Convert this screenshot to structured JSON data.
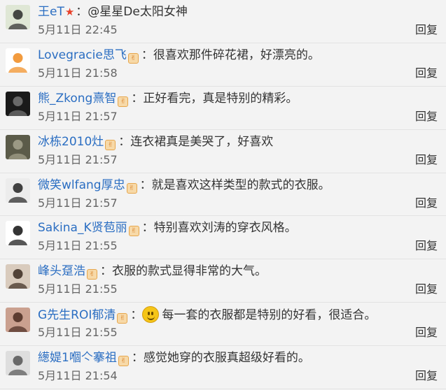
{
  "colon": "：",
  "reply_label": "回复",
  "comments": [
    {
      "user": "王eT",
      "star": true,
      "vip": false,
      "text": "@星星De太阳女神",
      "time": "5月11日 22:45",
      "avatar": {
        "bg": "#dfe7d5",
        "fg": "#2a2a2a"
      }
    },
    {
      "user": "Lovegracie思飞",
      "vip": true,
      "text": "很喜欢那件碎花裙，好漂亮的。",
      "time": "5月11日 21:58",
      "avatar": {
        "bg": "#ffffff",
        "fg": "#f08a1c"
      }
    },
    {
      "user": "熊_Zkong熹智",
      "vip": true,
      "text": "正好看完，真是特别的精彩。",
      "time": "5月11日 21:57",
      "avatar": {
        "bg": "#1a1a1a",
        "fg": "#777777"
      }
    },
    {
      "user": "冰栋2010灶",
      "vip": true,
      "text": "连衣裙真是美哭了，好喜欢",
      "time": "5月11日 21:57",
      "avatar": {
        "bg": "#5b5b49",
        "fg": "#a7a48e"
      }
    },
    {
      "user": "微笑wlfang厚忠",
      "vip": true,
      "text": "就是喜欢这样类型的款式的衣服。",
      "time": "5月11日 21:57",
      "avatar": {
        "bg": "#ececec",
        "fg": "#222222"
      }
    },
    {
      "user": "Sakina_K贤苞丽",
      "vip": true,
      "text": "特别喜欢刘涛的穿衣风格。",
      "time": "5月11日 21:55",
      "avatar": {
        "bg": "#ffffff",
        "fg": "#111111"
      }
    },
    {
      "user": "峰头趸浩",
      "vip": true,
      "text": "衣服的款式显得非常的大气。",
      "time": "5月11日 21:55",
      "avatar": {
        "bg": "#d9cbbd",
        "fg": "#3a2a20"
      }
    },
    {
      "user": "G先生ROI郁清",
      "vip": true,
      "emoji": true,
      "text": "每一套的衣服都是特别的好看，很适合。",
      "time": "5月11日 21:55",
      "avatar": {
        "bg": "#caa08f",
        "fg": "#4a2a20"
      }
    },
    {
      "user": "繱媞1嗰亽搴祖",
      "vip": true,
      "text": "感觉她穿的衣服真超级好看的。",
      "time": "5月11日 21:54",
      "avatar": {
        "bg": "#dedede",
        "fg": "#555555"
      }
    }
  ]
}
